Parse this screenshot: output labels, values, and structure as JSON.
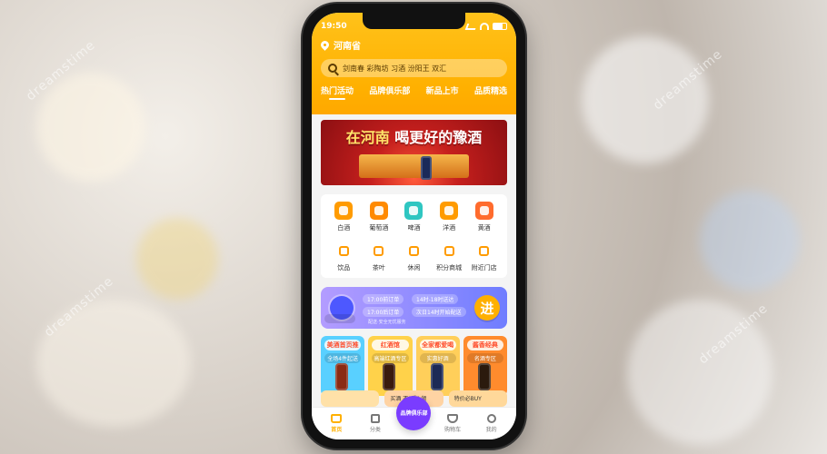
{
  "colors": {
    "accent": "#ffb000",
    "brand_purple": "#7a3cff",
    "banner_red": "#c51f1d",
    "text_dark": "#333333"
  },
  "watermarks": [
    {
      "text": "dreamstime"
    },
    {
      "text": "dreamstime"
    },
    {
      "text": "dreamstime"
    },
    {
      "text": "dreamstime"
    }
  ],
  "status": {
    "time": "19:50"
  },
  "header": {
    "location": "河南省",
    "search_text": "剑南春 彩陶坊 习酒 汾阳王 双汇",
    "tabs": [
      {
        "label": "热门活动"
      },
      {
        "label": "品牌俱乐部"
      },
      {
        "label": "新品上市"
      },
      {
        "label": "品质精选"
      }
    ]
  },
  "banner": {
    "title_part1": "在河南",
    "title_part2": "喝更好的豫酒"
  },
  "categories": [
    {
      "label": "白酒",
      "icon": "baijiu-icon",
      "color": "#ff9b00"
    },
    {
      "label": "葡萄酒",
      "icon": "wine-icon",
      "color": "#ff8a00"
    },
    {
      "label": "啤酒",
      "icon": "beer-icon",
      "color": "#2fc6c1"
    },
    {
      "label": "洋酒",
      "icon": "xo-icon",
      "color": "#ff9b00"
    },
    {
      "label": "黄酒",
      "icon": "yellow-wine-icon",
      "color": "#ff6b2d"
    },
    {
      "label": "饮品",
      "icon": "drink-icon",
      "color": "#ff9b00",
      "outline": true
    },
    {
      "label": "茶叶",
      "icon": "tea-icon",
      "color": "#ff9b00",
      "outline": true
    },
    {
      "label": "休闲",
      "icon": "snack-icon",
      "color": "#ff9b00",
      "outline": true
    },
    {
      "label": "积分商城",
      "icon": "points-icon",
      "color": "#ff9b00",
      "outline": true
    },
    {
      "label": "附近门店",
      "icon": "store-location-icon",
      "color": "#ff9b00",
      "outline": true
    }
  ],
  "delivery": {
    "pill_1": "17:00前订单",
    "pill_2": "14时-18时送达",
    "pill_3": "17:00后订单",
    "pill_4": "次日14时开始配送",
    "note": "配送·安全无忧服务",
    "go": "进"
  },
  "promos": [
    {
      "title": "美酒首页推",
      "subtitle": "全场4件起送",
      "bg": "#59d0ff"
    },
    {
      "title": "红酒馆",
      "subtitle": "高端红酒专区",
      "bg": "#ffd24a"
    },
    {
      "title": "全家都爱喝",
      "subtitle": "实惠好酒",
      "bg": "#ffcf5a"
    },
    {
      "title": "酱香经典",
      "subtitle": "名酒专区",
      "bg": "#ff8b2d"
    }
  ],
  "bottom_strip": {
    "card_1": "",
    "card_2": "买酒 不“乐” 领",
    "card_3": "特价必BUY"
  },
  "tabbar": {
    "items": [
      {
        "label": "首页",
        "icon": "home-icon",
        "active": true
      },
      {
        "label": "分类",
        "icon": "category-icon",
        "active": false
      },
      {
        "label": "品牌俱乐部",
        "icon": "club-icon",
        "active": false,
        "center": true
      },
      {
        "label": "购物车",
        "icon": "cart-icon",
        "active": false
      },
      {
        "label": "我的",
        "icon": "profile-icon",
        "active": false
      }
    ]
  }
}
